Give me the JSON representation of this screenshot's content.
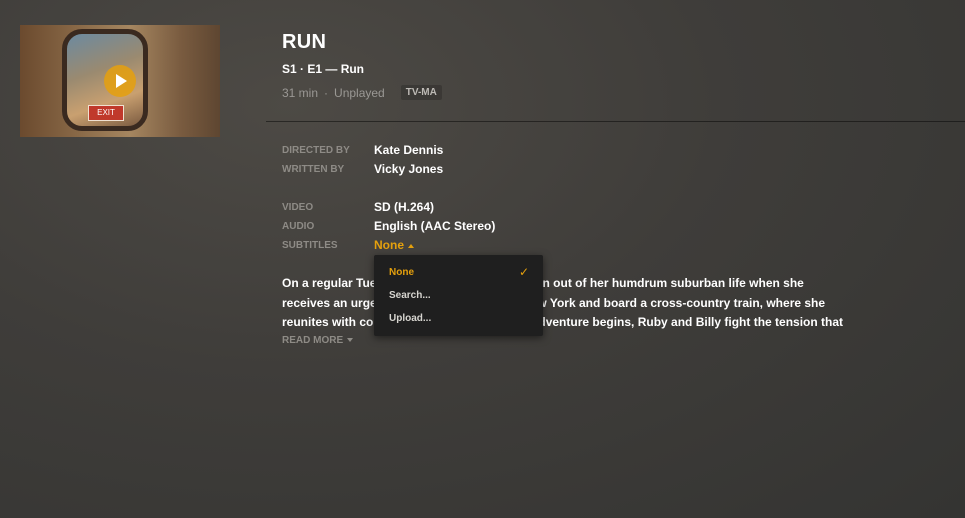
{
  "episode": {
    "title": "RUN",
    "subtitle": "S1 · E1 — Run",
    "duration": "31 min",
    "separator": "·",
    "status": "Unplayed",
    "rating": "TV-MA",
    "thumbnail_sign": "EXIT"
  },
  "credits": {
    "directed_label": "DIRECTED BY",
    "directed_value": "Kate Dennis",
    "written_label": "WRITTEN BY",
    "written_value": "Vicky Jones"
  },
  "media": {
    "video_label": "VIDEO",
    "video_value": "SD (H.264)",
    "audio_label": "AUDIO",
    "audio_value": "English (AAC Stereo)",
    "subtitles_label": "SUBTITLES",
    "subtitles_value": "None"
  },
  "summary": {
    "line1_start": "On a regular Tue",
    "line1_end": "n is shaken out of her humdrum suburban life when she",
    "line2_start": "receives an urger",
    "line2_end": "to New York and board a cross-country train, where she",
    "line3_start": "reunites with col",
    "line3_end": "adventure begins, Ruby and Billy fight the tension that",
    "read_more": "READ MORE"
  },
  "subtitle_menu": {
    "items": [
      "None",
      "Search...",
      "Upload..."
    ],
    "selected_index": 0,
    "check_icon": "checkmark-icon"
  },
  "colors": {
    "accent": "#e5a00d",
    "background": "#3f3d3a",
    "menu_background": "#1f1f1f"
  }
}
